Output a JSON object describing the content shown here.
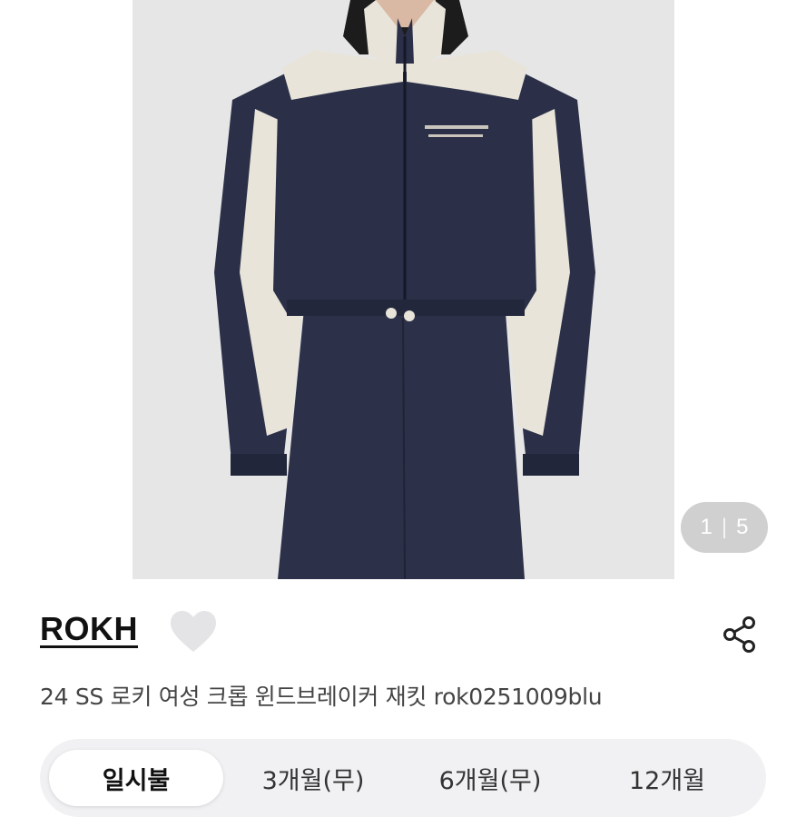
{
  "gallery": {
    "current_page": "1",
    "total_pages": "5",
    "image_alt": "product-photo-cropped-windbreaker-jacket"
  },
  "product": {
    "brand": "ROKH",
    "title": "24 SS 로키 여성 크롭 윈드브레이커 재킷 rok0251009blu",
    "wishlist_icon": "heart-icon",
    "share_icon": "share-icon"
  },
  "payment_options": {
    "options": [
      {
        "label": "일시불",
        "selected": true
      },
      {
        "label": "3개월(무)",
        "selected": false
      },
      {
        "label": "6개월(무)",
        "selected": false
      },
      {
        "label": "12개월",
        "selected": false
      }
    ]
  },
  "colors": {
    "jacket_navy": "#2b3048",
    "jacket_cream": "#e8e4da",
    "background": "#e6e6e6"
  }
}
